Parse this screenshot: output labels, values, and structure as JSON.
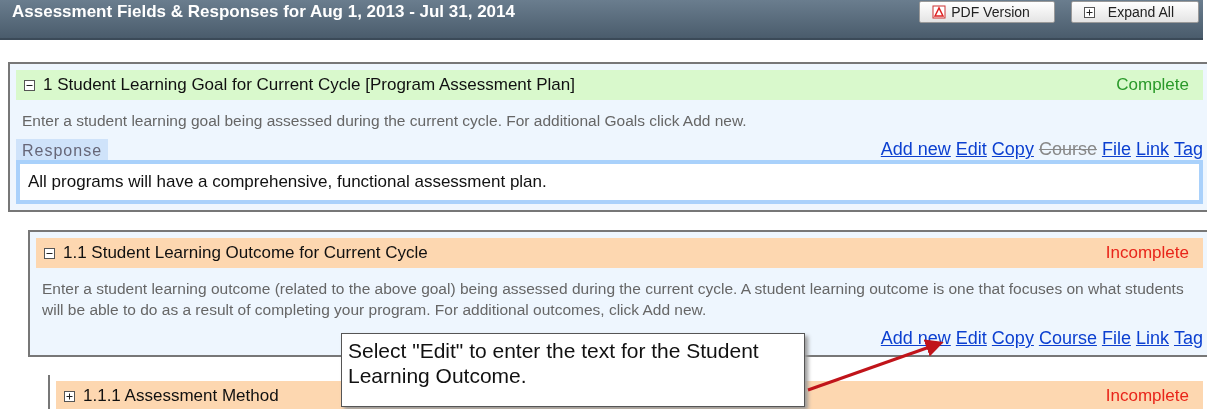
{
  "header": {
    "title": "Assessment Fields & Responses for Aug 1, 2013 - Jul 31, 2014",
    "buttons": [
      {
        "label": "PDF Version",
        "kind": "pdf"
      },
      {
        "label": "Expand All",
        "kind": "expand"
      }
    ]
  },
  "sections": [
    {
      "number": "1",
      "title": "Student Learning Goal for Current Cycle [Program Assessment Plan]",
      "expanded": true,
      "complete": true,
      "status": "Complete",
      "description": "Enter a student learning goal being assessed during the current cycle. For additional Goals click Add new.",
      "response": {
        "label": "Response",
        "text": "All programs will have a comprehensive, functional assessment plan."
      },
      "links": [
        {
          "label": "Add new",
          "disabled": false
        },
        {
          "label": "Edit",
          "disabled": false
        },
        {
          "label": "Copy",
          "disabled": false
        },
        {
          "label": "Course",
          "disabled": true
        },
        {
          "label": "File",
          "disabled": false
        },
        {
          "label": "Link",
          "disabled": false
        },
        {
          "label": "Tag",
          "disabled": false
        }
      ],
      "children": [
        {
          "number": "1.1",
          "title": "Student Learning Outcome for Current Cycle",
          "expanded": true,
          "complete": false,
          "status": "Incomplete",
          "description": "Enter a student learning outcome (related to the above goal) being assessed during the current cycle. A student learning outcome is one that focuses on what students will be able to do as a result of completing your program. For additional outcomes, click Add new.",
          "links": [
            {
              "label": "Add new",
              "disabled": false
            },
            {
              "label": "Edit",
              "disabled": false
            },
            {
              "label": "Copy",
              "disabled": false
            },
            {
              "label": "Course",
              "disabled": false
            },
            {
              "label": "File",
              "disabled": false
            },
            {
              "label": "Link",
              "disabled": false
            },
            {
              "label": "Tag",
              "disabled": false
            }
          ],
          "children": [
            {
              "number": "1.1.1",
              "title": "Assessment Method",
              "expanded": false,
              "complete": false,
              "status": "Incomplete"
            }
          ]
        }
      ]
    }
  ],
  "callout": {
    "text": "Select \"Edit\" to enter the text for the Student Learning Outcome."
  }
}
